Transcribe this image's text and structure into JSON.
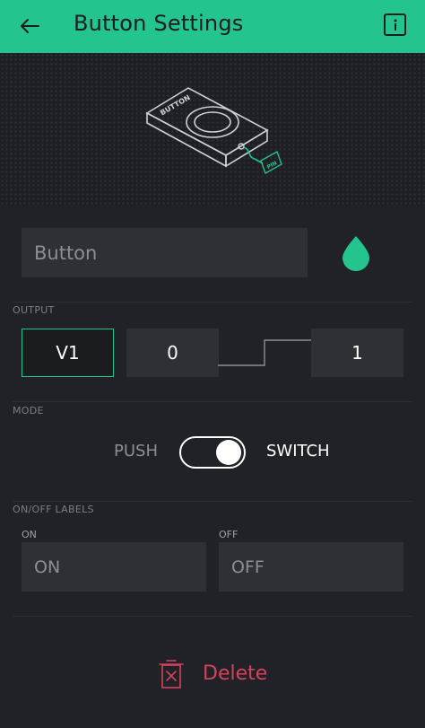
{
  "header": {
    "title": "Button Settings",
    "accent_color": "#23c48e",
    "back_icon": "arrow-left-icon",
    "info_icon": "info-icon"
  },
  "hero": {
    "device_label": "BUTTON",
    "pin_label": "PIN"
  },
  "widget": {
    "name_placeholder": "Button",
    "color_icon": "droplet-icon",
    "widget_color": "#23c48e"
  },
  "output": {
    "section_label": "OUTPUT",
    "pin": "V1",
    "low_value": "0",
    "high_value": "1"
  },
  "mode": {
    "section_label": "MODE",
    "push_label": "PUSH",
    "switch_label": "SWITCH",
    "selected": "SWITCH"
  },
  "labels": {
    "section_label": "ON/OFF LABELS",
    "on_caption": "ON",
    "off_caption": "OFF",
    "on_placeholder": "ON",
    "off_placeholder": "OFF"
  },
  "footer": {
    "delete_label": "Delete",
    "delete_icon": "trash-icon",
    "delete_color": "#d3435c"
  }
}
